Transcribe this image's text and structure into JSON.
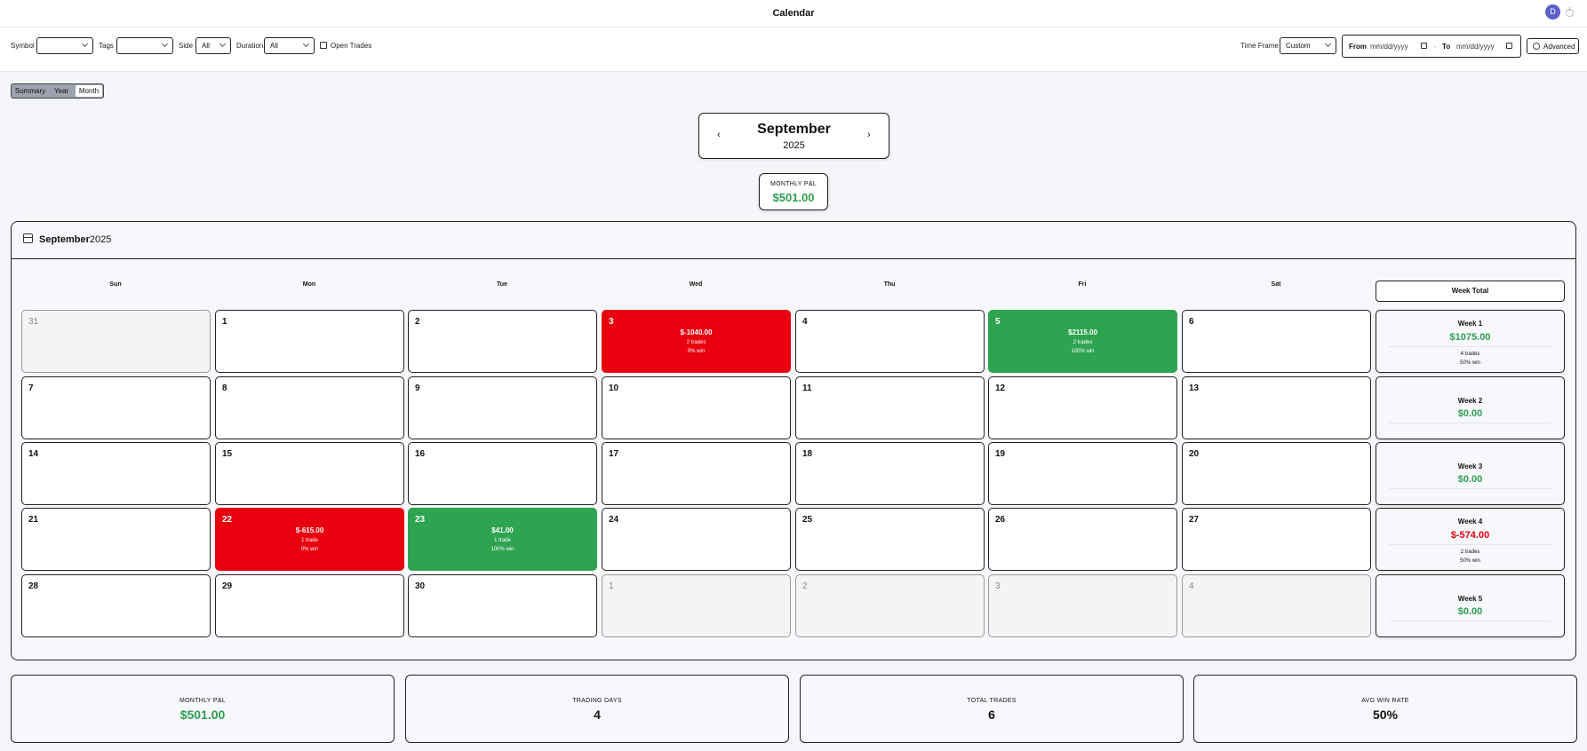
{
  "app": {
    "title": "Calendar",
    "avatar_initial": "D"
  },
  "filters": {
    "symbol_label": "Symbol",
    "symbol_value": "",
    "tags_label": "Tags",
    "tags_value": "",
    "side_label": "Side",
    "side_value": "All",
    "duration_label": "Duration",
    "duration_value": "All",
    "open_trades_label": "Open Trades",
    "timeframe_label": "Time Frame",
    "timeframe_value": "Custom",
    "from_label": "From",
    "from_placeholder": "mm/dd/yyyy",
    "range_sep": "-",
    "to_label": "To",
    "to_placeholder": "mm/dd/yyyy",
    "advanced_label": "Advanced"
  },
  "views": {
    "summary": "Summary",
    "year": "Year",
    "month": "Month",
    "active": "Month"
  },
  "month_nav": {
    "month": "September",
    "year": "2025",
    "prev": "‹",
    "next": "›"
  },
  "monthly_pnl": {
    "label": "MONTHLY P&L",
    "value": "$501.00"
  },
  "calendar": {
    "header_month": "September",
    "header_year": "2025",
    "weekdays": [
      "Sun",
      "Mon",
      "Tue",
      "Wed",
      "Thu",
      "Fri",
      "Sat"
    ],
    "week_total_label": "Week Total",
    "weeks": [
      {
        "days": [
          {
            "day": "31",
            "other": true
          },
          {
            "day": "1"
          },
          {
            "day": "2"
          },
          {
            "day": "3",
            "status": "loss",
            "pnl": "$-1040.00",
            "trades": "2 trades",
            "win": "0% win"
          },
          {
            "day": "4"
          },
          {
            "day": "5",
            "status": "win",
            "pnl": "$2115.00",
            "trades": "2 trades",
            "win": "100% win"
          },
          {
            "day": "6"
          }
        ],
        "total": {
          "label": "Week 1",
          "value": "$1075.00",
          "sign": "pos",
          "trades": "4 trades",
          "win": "50% win"
        }
      },
      {
        "days": [
          {
            "day": "7"
          },
          {
            "day": "8"
          },
          {
            "day": "9"
          },
          {
            "day": "10"
          },
          {
            "day": "11"
          },
          {
            "day": "12"
          },
          {
            "day": "13"
          }
        ],
        "total": {
          "label": "Week 2",
          "value": "$0.00",
          "sign": "pos"
        }
      },
      {
        "days": [
          {
            "day": "14"
          },
          {
            "day": "15"
          },
          {
            "day": "16"
          },
          {
            "day": "17"
          },
          {
            "day": "18"
          },
          {
            "day": "19"
          },
          {
            "day": "20"
          }
        ],
        "total": {
          "label": "Week 3",
          "value": "$0.00",
          "sign": "pos"
        }
      },
      {
        "days": [
          {
            "day": "21"
          },
          {
            "day": "22",
            "status": "loss",
            "pnl": "$-615.00",
            "trades": "1 trade",
            "win": "0% win"
          },
          {
            "day": "23",
            "status": "win",
            "pnl": "$41.00",
            "trades": "1 trade",
            "win": "100% win"
          },
          {
            "day": "24"
          },
          {
            "day": "25"
          },
          {
            "day": "26"
          },
          {
            "day": "27"
          }
        ],
        "total": {
          "label": "Week 4",
          "value": "$-574.00",
          "sign": "neg",
          "trades": "2 trades",
          "win": "50% win"
        }
      },
      {
        "days": [
          {
            "day": "28"
          },
          {
            "day": "29"
          },
          {
            "day": "30"
          },
          {
            "day": "1",
            "other": true
          },
          {
            "day": "2",
            "other": true
          },
          {
            "day": "3",
            "other": true
          },
          {
            "day": "4",
            "other": true
          }
        ],
        "total": {
          "label": "Week 5",
          "value": "$0.00",
          "sign": "pos"
        }
      }
    ]
  },
  "stats": [
    {
      "label": "MONTHLY P&L",
      "value": "$501.00",
      "green": true
    },
    {
      "label": "TRADING DAYS",
      "value": "4"
    },
    {
      "label": "TOTAL TRADES",
      "value": "6"
    },
    {
      "label": "AVG WIN RATE",
      "value": "50%"
    }
  ],
  "colors": {
    "loss": "#e8000f",
    "win": "#2fa450",
    "positive_text": "#2e9e4f",
    "avatar": "#5b5fc7"
  }
}
